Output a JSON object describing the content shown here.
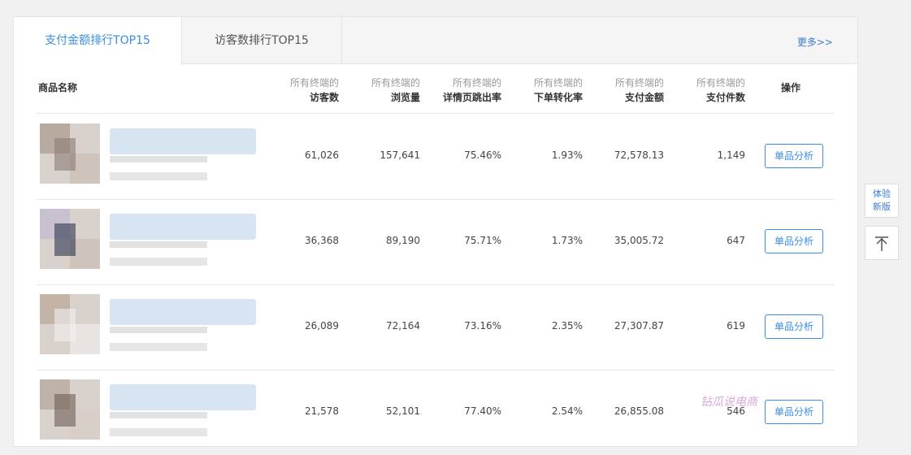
{
  "tabs": [
    {
      "label": "支付金额排行TOP15"
    },
    {
      "label": "访客数排行TOP15"
    }
  ],
  "more_label": "更多>>",
  "columns": {
    "product_name": "商品名称",
    "operation": "操作",
    "metrics": [
      {
        "sub": "所有终端的",
        "main": "访客数"
      },
      {
        "sub": "所有终端的",
        "main": "浏览量"
      },
      {
        "sub": "所有终端的",
        "main": "详情页跳出率"
      },
      {
        "sub": "所有终端的",
        "main": "下单转化率"
      },
      {
        "sub": "所有终端的",
        "main": "支付金额"
      },
      {
        "sub": "所有终端的",
        "main": "支付件数"
      }
    ]
  },
  "rows": [
    {
      "visitors": "61,026",
      "pageviews": "157,641",
      "bounce": "75.46%",
      "conversion": "1.93%",
      "amount": "72,578.13",
      "pieces": "1,149",
      "action": "单品分析"
    },
    {
      "visitors": "36,368",
      "pageviews": "89,190",
      "bounce": "75.71%",
      "conversion": "1.73%",
      "amount": "35,005.72",
      "pieces": "647",
      "action": "单品分析"
    },
    {
      "visitors": "26,089",
      "pageviews": "72,164",
      "bounce": "73.16%",
      "conversion": "2.35%",
      "amount": "27,307.87",
      "pieces": "619",
      "action": "单品分析"
    },
    {
      "visitors": "21,578",
      "pageviews": "52,101",
      "bounce": "77.40%",
      "conversion": "2.54%",
      "amount": "26,855.08",
      "pieces": "546",
      "action": "单品分析"
    }
  ],
  "side": {
    "new_version_line1": "体验",
    "new_version_line2": "新版",
    "top_icon": "arrow-up-to-top-icon"
  },
  "watermark": "钻瓜说电商"
}
